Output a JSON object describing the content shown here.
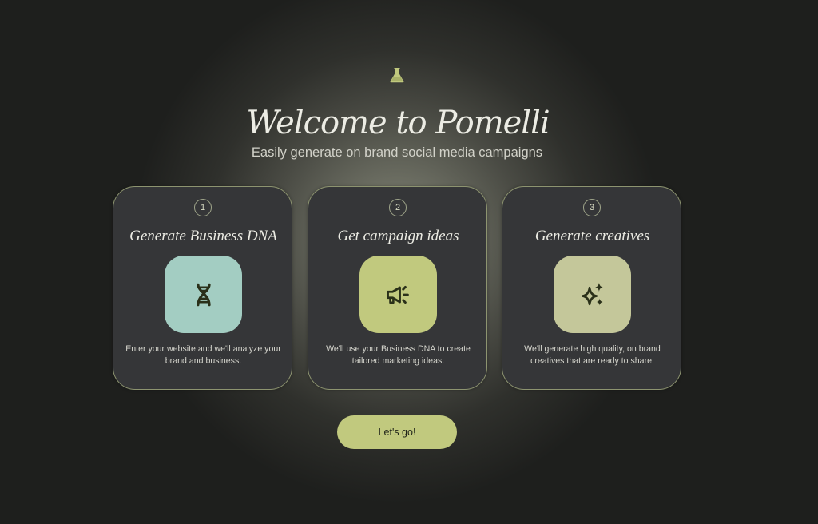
{
  "header": {
    "logo_icon": "flask-icon",
    "title": "Welcome to Pomelli",
    "subtitle": "Easily generate on brand social media campaigns"
  },
  "steps": [
    {
      "number": "1",
      "title": "Generate Business DNA",
      "icon": "dna-icon",
      "tile_color": "#a3cdc2",
      "description": "Enter your website and we'll analyze your brand and business."
    },
    {
      "number": "2",
      "title": "Get campaign ideas",
      "icon": "megaphone-icon",
      "tile_color": "#c1c97e",
      "description": "We'll use your Business DNA to create tailored marketing ideas."
    },
    {
      "number": "3",
      "title": "Generate creatives",
      "icon": "sparkle-icon",
      "tile_color": "#c4c79a",
      "description": "We'll generate high quality, on brand creatives that are ready to share."
    }
  ],
  "cta": {
    "label": "Let's go!"
  },
  "colors": {
    "accent": "#c1c97e",
    "card_bg": "#353638",
    "card_border": "#8d9470",
    "icon_color": "#2a3019"
  }
}
